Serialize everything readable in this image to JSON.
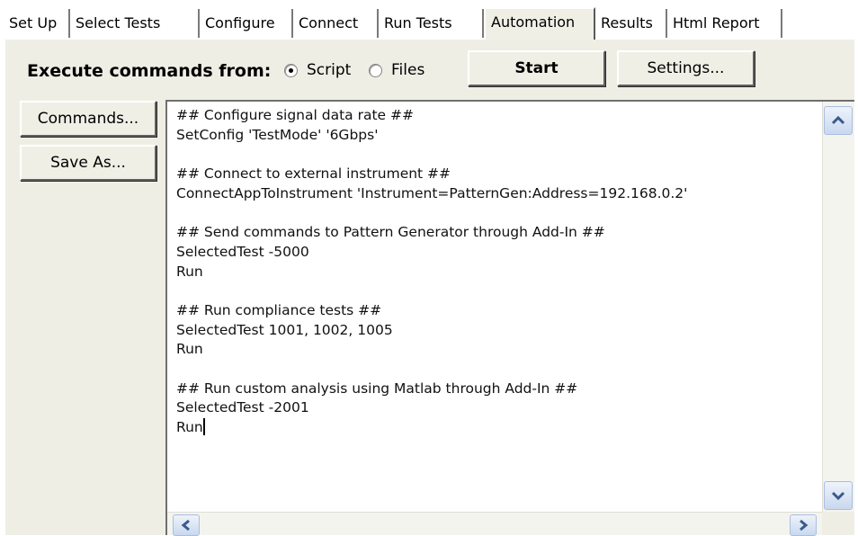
{
  "tabs": [
    "Set Up",
    "Select Tests",
    "Configure",
    "Connect",
    "Run Tests",
    "Automation",
    "Results",
    "Html Report"
  ],
  "active_tab": "Automation",
  "execute": {
    "label": "Execute commands from:",
    "options": [
      "Script",
      "Files"
    ],
    "selected": "Script"
  },
  "buttons": {
    "start": "Start",
    "settings": "Settings...",
    "commands": "Commands...",
    "save_as": "Save As..."
  },
  "script_lines": [
    "## Configure signal data rate ##",
    "SetConfig 'TestMode' '6Gbps'",
    "",
    "## Connect to external instrument ##",
    "ConnectAppToInstrument 'Instrument=PatternGen:Address=192.168.0.2'",
    "",
    "## Send commands to Pattern Generator through Add-In ##",
    "SelectedTest -5000",
    "Run",
    "",
    "## Run compliance tests ##",
    "SelectedTest 1001, 1002, 1005",
    "Run",
    "",
    "## Run custom analysis using Matlab through Add-In ##",
    "SelectedTest -2001",
    "Run"
  ],
  "colors": {
    "panel": "#efeee5",
    "scroll_button": "#c9d8ef",
    "arrow": "#3a5a8c"
  },
  "icons": {
    "scroll_up": "chevron-up-icon",
    "scroll_down": "chevron-down-icon",
    "scroll_left": "chevron-left-icon",
    "scroll_right": "chevron-right-icon"
  }
}
